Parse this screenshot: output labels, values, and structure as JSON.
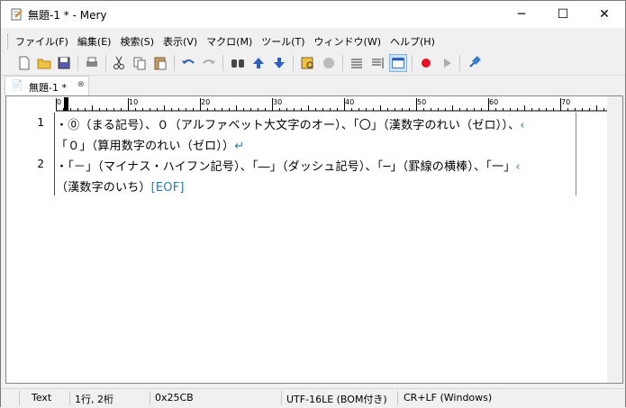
{
  "window": {
    "title": "無題-1 * - Mery",
    "minimize": "─",
    "maximize": "☐",
    "close": "✕"
  },
  "menu": {
    "items": [
      "ファイル(F)",
      "編集(E)",
      "検索(S)",
      "表示(V)",
      "マクロ(M)",
      "ツール(T)",
      "ウィンドウ(W)",
      "ヘルプ(H)"
    ]
  },
  "toolbar": {
    "icons": [
      "new-file-icon",
      "open-folder-icon",
      "save-icon",
      "print-icon",
      "cut-icon",
      "copy-icon",
      "paste-icon",
      "undo-icon",
      "redo-icon",
      "find-icon",
      "find-up-icon",
      "find-down-icon",
      "mark-icon",
      "disabled-circle-icon",
      "list-icon",
      "wrap-icon",
      "window-icon",
      "record-icon",
      "play-icon",
      "pin-icon"
    ]
  },
  "tab": {
    "label": "無題-1 *",
    "close": "⊗"
  },
  "ruler": {
    "labels": [
      "0",
      "10",
      "20",
      "30",
      "40",
      "50",
      "60",
      "70"
    ]
  },
  "editor": {
    "line_numbers": [
      "1",
      "2"
    ],
    "lines": [
      "・⓪（まる記号）、０（アルファベット大文字のオー）、「〇」（漢数字のれい（ゼロ））、",
      "「０」（算用数字のれい（ゼロ））",
      "・「－」（マイナス・ハイフン記号）、「―」（ダッシュ記号）、「─」（罫線の横棒）、「一」",
      "（漢数字のいち）"
    ],
    "wrap_mark": "‹",
    "newline_mark": "↵",
    "eof_mark": "[EOF]"
  },
  "status": {
    "mode": "Text",
    "position": "1行, 2桁",
    "char_code": "0x25CB",
    "encoding": "UTF-16LE (BOM付き)",
    "line_ending": "CR+LF (Windows)"
  },
  "colors": {
    "accent": "#2a7ab0",
    "record": "#e81123"
  }
}
